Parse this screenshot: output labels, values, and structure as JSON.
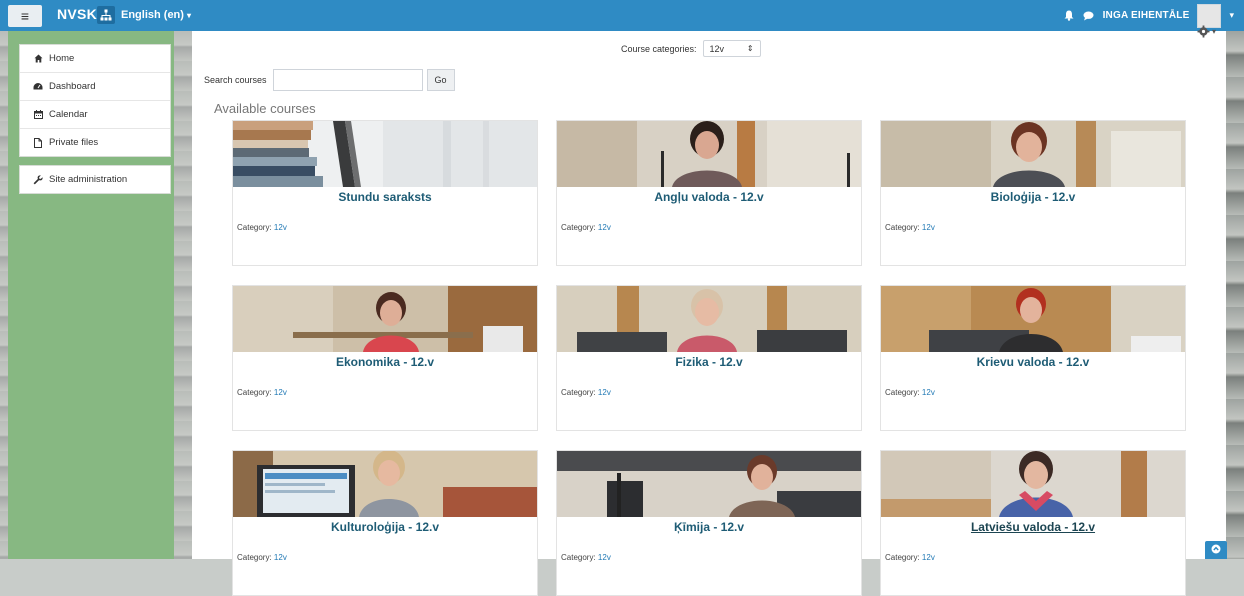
{
  "navbar": {
    "brand": "NVSK",
    "language": "English (en)",
    "user_name": "INGA EIHENTĀLE",
    "colors": {
      "bar": "#2f8bc4"
    }
  },
  "drawer": {
    "items": [
      {
        "label": "Home",
        "icon": "home-icon"
      },
      {
        "label": "Dashboard",
        "icon": "dashboard-icon"
      },
      {
        "label": "Calendar",
        "icon": "calendar-icon"
      },
      {
        "label": "Private files",
        "icon": "file-icon"
      }
    ],
    "admin": {
      "label": "Site administration",
      "icon": "wrench-icon"
    }
  },
  "main": {
    "category_label": "Course categories:",
    "category_value": "12v",
    "search_label": "Search courses",
    "search_value": "",
    "go_label": "Go",
    "available_title": "Available courses",
    "category_prefix": "Category:",
    "courses": [
      {
        "title": "Stundu saraksts",
        "category": "12v"
      },
      {
        "title": "Angļu valoda - 12.v",
        "category": "12v"
      },
      {
        "title": "Bioloģija - 12.v",
        "category": "12v"
      },
      {
        "title": "Ekonomika - 12.v",
        "category": "12v"
      },
      {
        "title": "Fizika - 12.v",
        "category": "12v"
      },
      {
        "title": "Krievu valoda - 12.v",
        "category": "12v"
      },
      {
        "title": "Kulturoloģija - 12.v",
        "category": "12v"
      },
      {
        "title": "Ķīmija - 12.v",
        "category": "12v"
      },
      {
        "title": "Latviešu valoda - 12.v",
        "category": "12v"
      }
    ]
  }
}
